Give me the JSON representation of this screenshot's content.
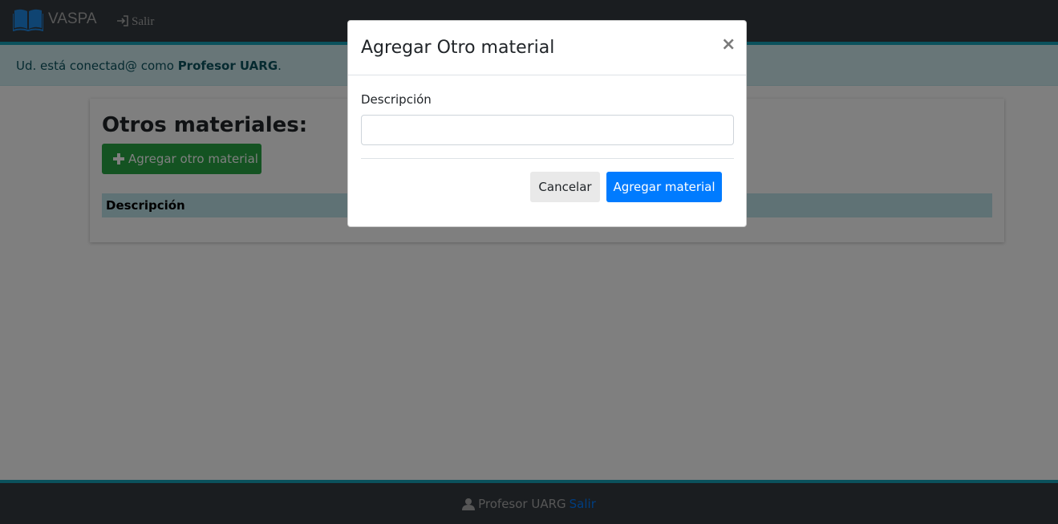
{
  "navbar": {
    "brand": "VASPA",
    "logout_label": "Salir",
    "brand_icon": "book-icon",
    "logout_icon": "sign-out-icon"
  },
  "alert": {
    "prefix": "Ud. está conectad@ como ",
    "user": "Profesor UARG",
    "suffix": "."
  },
  "main": {
    "title": "Otros materiales:",
    "add_button_label": "Agregar otro material",
    "add_button_icon": "plus-icon",
    "table": {
      "columns": [
        "Descripción"
      ]
    }
  },
  "modal": {
    "title": "Agregar Otro material",
    "close_label": "×",
    "field_label": "Descripción",
    "field_value": "",
    "cancel_label": "Cancelar",
    "submit_label": "Agregar material"
  },
  "footer": {
    "user": "Profesor UARG",
    "logout_label": "Salir",
    "user_icon": "user-icon"
  },
  "colors": {
    "navbar": "#343a40",
    "accent": "#17a2b8",
    "alert_bg": "#d1ecf1",
    "success": "#28a745",
    "primary": "#007bff"
  }
}
